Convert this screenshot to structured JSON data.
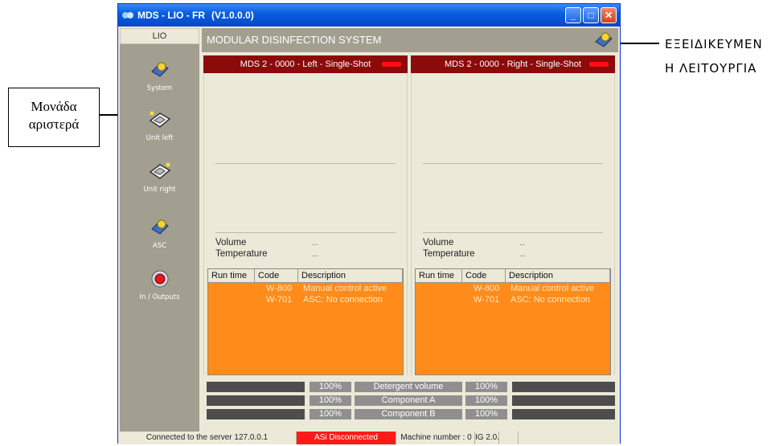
{
  "annotations": {
    "left_callout": "Μονάδα αριστερά",
    "left_callout_line1": "Μονάδα",
    "left_callout_line2": "αριστερά",
    "right_callout_line1": "ΕΞΕΙΔΙΚΕΥΜΕΝ",
    "right_callout_line2": "Η ΛΕΙΤΟΥΡΓΙΑ"
  },
  "window": {
    "title_left": "MDS - LIO - FR",
    "title_version": "(V1.0.0.0)"
  },
  "sidebar": {
    "tab_label": "LIO",
    "items": [
      {
        "label": "System",
        "icon": "system-gear-icon"
      },
      {
        "label": "Unit left",
        "icon": "unit-left-icon"
      },
      {
        "label": "Unit right",
        "icon": "unit-right-icon"
      },
      {
        "label": "ASC",
        "icon": "asc-gear-icon"
      },
      {
        "label": "In / Outputs",
        "icon": "io-red-icon"
      }
    ]
  },
  "header": {
    "title": "MODULAR DISINFECTION SYSTEM"
  },
  "panels": [
    {
      "title": "MDS 2 - 0000 - Left - Single-Shot",
      "volume_label": "Volume",
      "volume_value": "...",
      "temperature_label": "Temperature",
      "temperature_value": "...",
      "table_headers": [
        "Run time",
        "Code",
        "Description"
      ],
      "rows": [
        {
          "run_time": "",
          "code": "W-800",
          "description": "Manual control active"
        },
        {
          "run_time": "",
          "code": "W-701",
          "description": "ASC: No connection"
        }
      ]
    },
    {
      "title": "MDS 2 - 0000 - Right - Single-Shot",
      "volume_label": "Volume",
      "volume_value": "...",
      "temperature_label": "Temperature",
      "temperature_value": "...",
      "table_headers": [
        "Run time",
        "Code",
        "Description"
      ],
      "rows": [
        {
          "run_time": "",
          "code": "W-800",
          "description": "Manual control active"
        },
        {
          "run_time": "",
          "code": "W-701",
          "description": "ASC: No connection"
        }
      ]
    }
  ],
  "levels": [
    {
      "label": "Detergent volume",
      "left_pct": "100%",
      "right_pct": "100%"
    },
    {
      "label": "Component A",
      "left_pct": "100%",
      "right_pct": "100%"
    },
    {
      "label": "Component B",
      "left_pct": "100%",
      "right_pct": "100%"
    }
  ],
  "status": {
    "server": "Connected to the server 127.0.0.1",
    "asi": "ASi Disconnected",
    "machine": "Machine number : 0",
    "version": "IG 2.0.("
  },
  "colors": {
    "panel_title_bg": "#8b0a0a",
    "led": "#ff1010",
    "message_bg": "#ff8c1a",
    "asi_status_bg": "#ff1a1a"
  }
}
